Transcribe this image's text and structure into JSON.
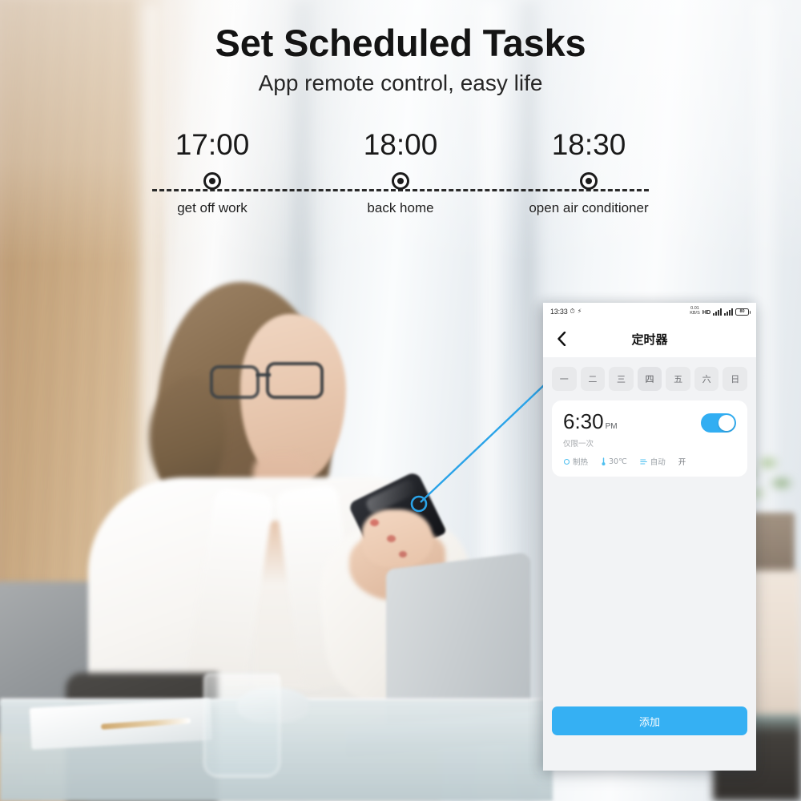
{
  "header": {
    "title": "Set Scheduled Tasks",
    "subtitle": "App remote control, easy life"
  },
  "timeline": {
    "stops": [
      {
        "time": "17:00",
        "label": "get off work"
      },
      {
        "time": "18:00",
        "label": "back home"
      },
      {
        "time": "18:30",
        "label": "open air conditioner"
      }
    ]
  },
  "phone": {
    "status_bar": {
      "clock": "13:33",
      "alarm_icon": "alarm-icon",
      "battery_saver_icon": "battery-saver-icon",
      "data_rate": "0.01\nKB/S",
      "hd_label": "HD",
      "signal_icon": "signal-bars-icon",
      "signal2_icon": "signal-bars-icon",
      "battery_level": "80"
    },
    "nav": {
      "back_icon": "back-chevron-icon",
      "title": "定时器"
    },
    "weekdays": [
      {
        "label": "一"
      },
      {
        "label": "二"
      },
      {
        "label": "三"
      },
      {
        "label": "四"
      },
      {
        "label": "五"
      },
      {
        "label": "六"
      },
      {
        "label": "日"
      }
    ],
    "timer_card": {
      "time": "6:30",
      "ampm": "PM",
      "repeat": "仅限一次",
      "tags": [
        {
          "icon": "mode-heat-icon",
          "label": "制热"
        },
        {
          "icon": "thermometer-icon",
          "label": "30℃"
        },
        {
          "icon": "fan-speed-icon",
          "label": "自动"
        },
        {
          "icon": "",
          "label": "开"
        }
      ],
      "toggle_on": true,
      "toggle_color": "#32aef2"
    },
    "add_button": {
      "label": "添加",
      "color": "#35b0f3"
    }
  },
  "callout": {
    "accent_color": "#2aa3e8"
  }
}
